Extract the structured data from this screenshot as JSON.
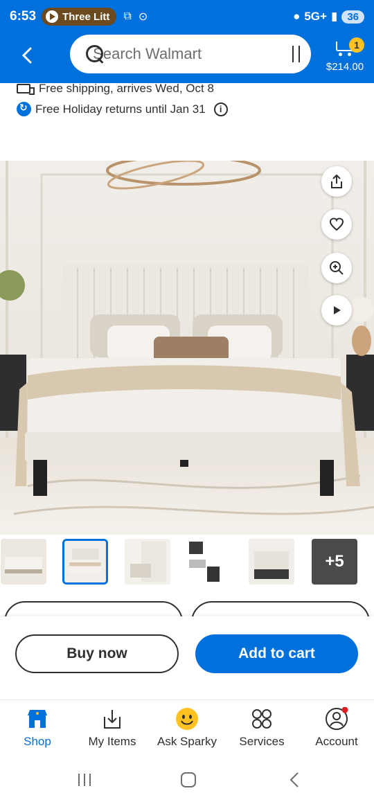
{
  "status_bar": {
    "time": "6:53",
    "media": "Three Litt",
    "network": "5G+",
    "battery": "36"
  },
  "header": {
    "search_placeholder": "Search Walmart",
    "cart_count": "1",
    "cart_total": "$214.00"
  },
  "shipping": {
    "delivery": "Free shipping, arrives Wed, Oct 8",
    "returns": "Free Holiday returns until Jan 31"
  },
  "gallery": {
    "selected_index": 1,
    "more_count": "+5"
  },
  "actions": {
    "buy_now": "Buy now",
    "add_to_cart": "Add to cart"
  },
  "bottom_nav": {
    "items": [
      {
        "label": "Shop",
        "icon": "shop-icon"
      },
      {
        "label": "My Items",
        "icon": "my-items-icon"
      },
      {
        "label": "Ask Sparky",
        "icon": "sparky-icon"
      },
      {
        "label": "Services",
        "icon": "services-icon"
      },
      {
        "label": "Account",
        "icon": "account-icon"
      }
    ]
  },
  "colors": {
    "brand_blue": "#0071dc",
    "spark_yellow": "#ffc220"
  }
}
